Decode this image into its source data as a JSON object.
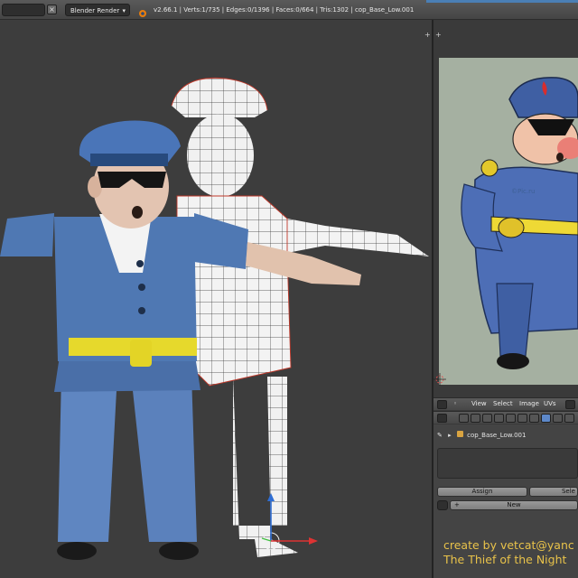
{
  "topbar": {
    "render_engine": "Blender Render",
    "stats": "v2.66.1 | Verts:1/735 | Edges:0/1396 | Faces:0/664 | Tris:1302 | cop_Base_Low.001"
  },
  "image_editor_header": {
    "menu": [
      "View",
      "Select",
      "Image",
      "UVs"
    ]
  },
  "properties": {
    "breadcrumb_object": "cop_Base_Low.001",
    "assign_label": "Assign",
    "select_label": "Sele",
    "new_label": "New"
  },
  "reference_image": {
    "watermark": "©Pic.ru"
  },
  "signature": {
    "line1": "create by vetcat@yanc",
    "line2": "The Thief of the Night"
  },
  "colors": {
    "uniform_blue": "#4f78b3",
    "belt_yellow": "#e6d92c",
    "signature_yellow": "#e8c24a"
  }
}
